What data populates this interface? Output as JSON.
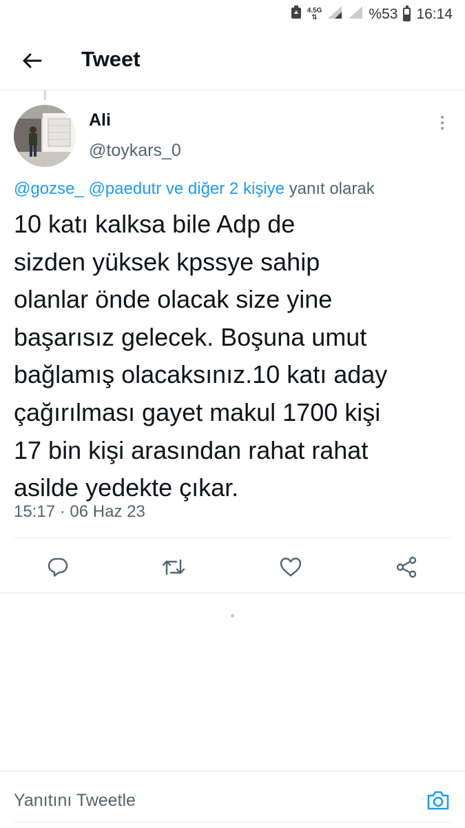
{
  "status_bar": {
    "network": "4.5G",
    "battery_text": "%53",
    "battery_level": 0.53,
    "time": "16:14"
  },
  "header": {
    "title": "Tweet",
    "back_icon": "arrow-left-icon"
  },
  "tweet": {
    "author_name": "Ali",
    "author_handle": "@toykars_0",
    "reply_to": {
      "mention_1": "@gozse_",
      "mention_2": "@paedutr",
      "others": "ve diğer 2 kişiye",
      "suffix": "yanıt olarak"
    },
    "text_lines": [
      "10 katı kalksa bile Adp de",
      "sizden yüksek kpssye sahip",
      "olanlar önde olacak size yine",
      "başarısız gelecek. Boşuna umut",
      "bağlamış olacaksınız.10 katı aday",
      "çağırılması gayet makul 1700 kişi",
      "17 bin kişi arasından rahat rahat",
      "asilde yedekte çıkar."
    ],
    "timestamp": "15:17 · 06 Haz 23"
  },
  "actions": {
    "reply_icon": "reply-icon",
    "retweet_icon": "retweet-icon",
    "like_icon": "heart-icon",
    "share_icon": "share-icon"
  },
  "composer": {
    "placeholder": "Yanıtını Tweetle",
    "value": ""
  },
  "colors": {
    "accent": "#1d9bf0",
    "text": "#0f1419",
    "secondary": "#536471",
    "border": "#e6e9eb"
  }
}
